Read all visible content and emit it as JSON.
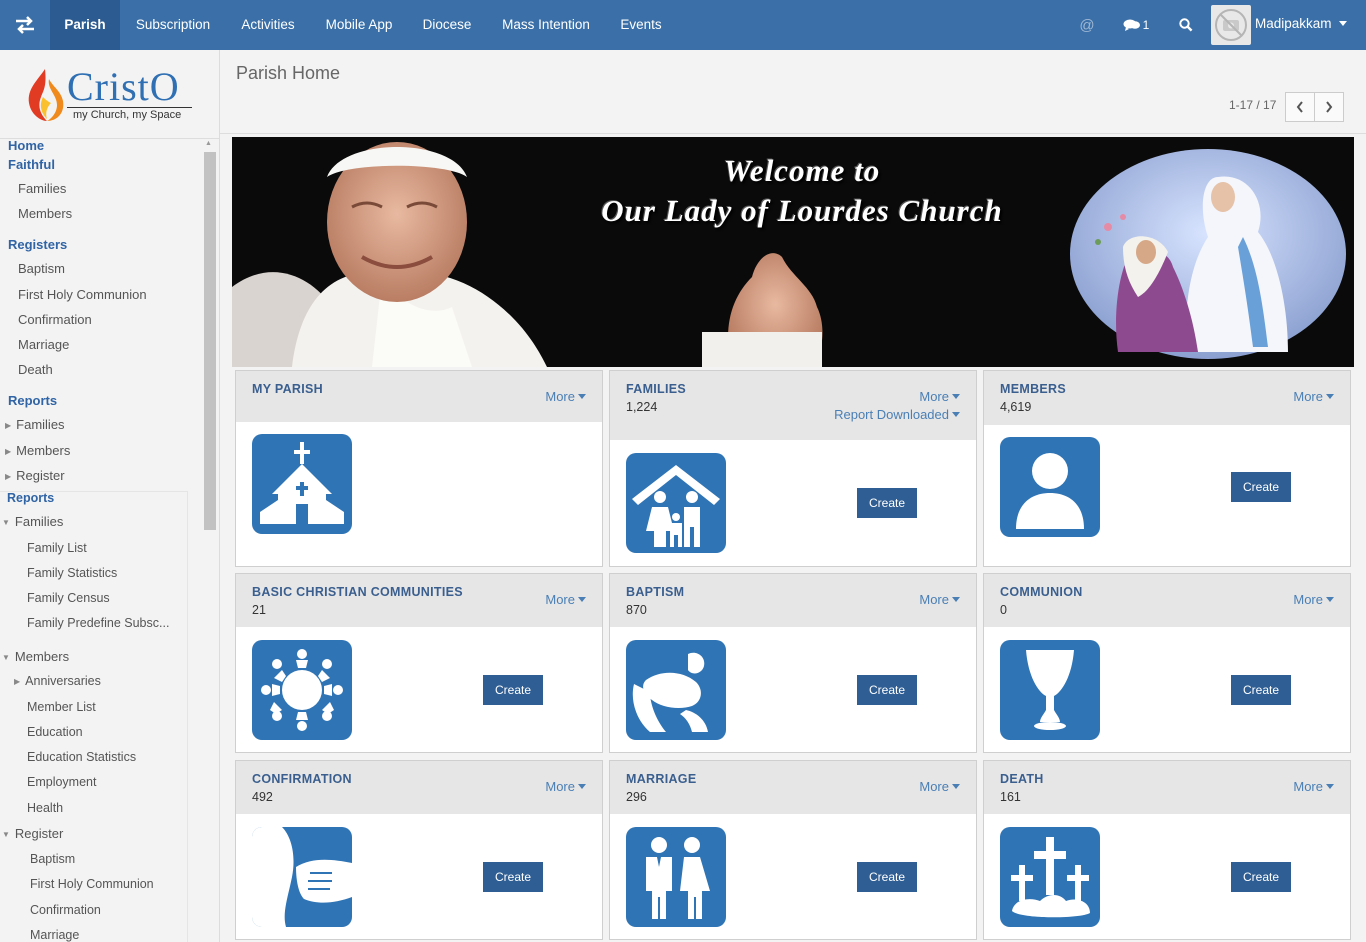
{
  "nav": {
    "items": [
      "Parish",
      "Subscription",
      "Activities",
      "Mobile App",
      "Diocese",
      "Mass Intention",
      "Events"
    ],
    "active": "Parish",
    "chat_count": "1",
    "username": "Madipakkam",
    "accent_color": "#3a6fa7"
  },
  "sidebar": {
    "logo_name": "CristO",
    "logo_tagline": "my Church, my Space",
    "home": "Home",
    "faithful": {
      "label": "Faithful",
      "items": [
        "Families",
        "Members"
      ]
    },
    "registers": {
      "label": "Registers",
      "items": [
        "Baptism",
        "First Holy Communion",
        "Confirmation",
        "Marriage",
        "Death"
      ]
    },
    "reports": {
      "label": "Reports",
      "items": [
        "Families",
        "Members",
        "Register"
      ]
    },
    "reports_tree": {
      "label": "Reports",
      "families": {
        "label": "Families",
        "items": [
          "Family List",
          "Family Statistics",
          "Family Census",
          "Family Predefine Subsc..."
        ]
      },
      "members": {
        "label": "Members",
        "anniversaries": "Anniversaries",
        "items": [
          "Member List",
          "Education",
          "Education Statistics",
          "Employment",
          "Health"
        ]
      },
      "register": {
        "label": "Register",
        "items": [
          "Baptism",
          "First Holy Communion",
          "Confirmation",
          "Marriage"
        ]
      }
    }
  },
  "main": {
    "title": "Parish Home",
    "pager": "1-17 / 17",
    "banner_line1": "Welcome  to",
    "banner_line2": "Our Lady of Lourdes  Church"
  },
  "cards": {
    "my_parish": {
      "title": "MY PARISH",
      "more": "More"
    },
    "families": {
      "title": "FAMILIES",
      "count": "1,224",
      "more": "More",
      "more2": "Report Downloaded",
      "create": "Create"
    },
    "members": {
      "title": "MEMBERS",
      "count": "4,619",
      "more": "More",
      "create": "Create"
    },
    "bcc": {
      "title": "BASIC CHRISTIAN COMMUNITIES",
      "count": "21",
      "more": "More",
      "create": "Create"
    },
    "baptism": {
      "title": "BAPTISM",
      "count": "870",
      "more": "More",
      "create": "Create"
    },
    "communion": {
      "title": "COMMUNION",
      "count": "0",
      "more": "More",
      "create": "Create"
    },
    "confirmation": {
      "title": "CONFIRMATION",
      "count": "492",
      "more": "More",
      "create": "Create"
    },
    "marriage": {
      "title": "MARRIAGE",
      "count": "296",
      "more": "More",
      "create": "Create"
    },
    "death": {
      "title": "DEATH",
      "count": "161",
      "more": "More",
      "create": "Create"
    }
  }
}
